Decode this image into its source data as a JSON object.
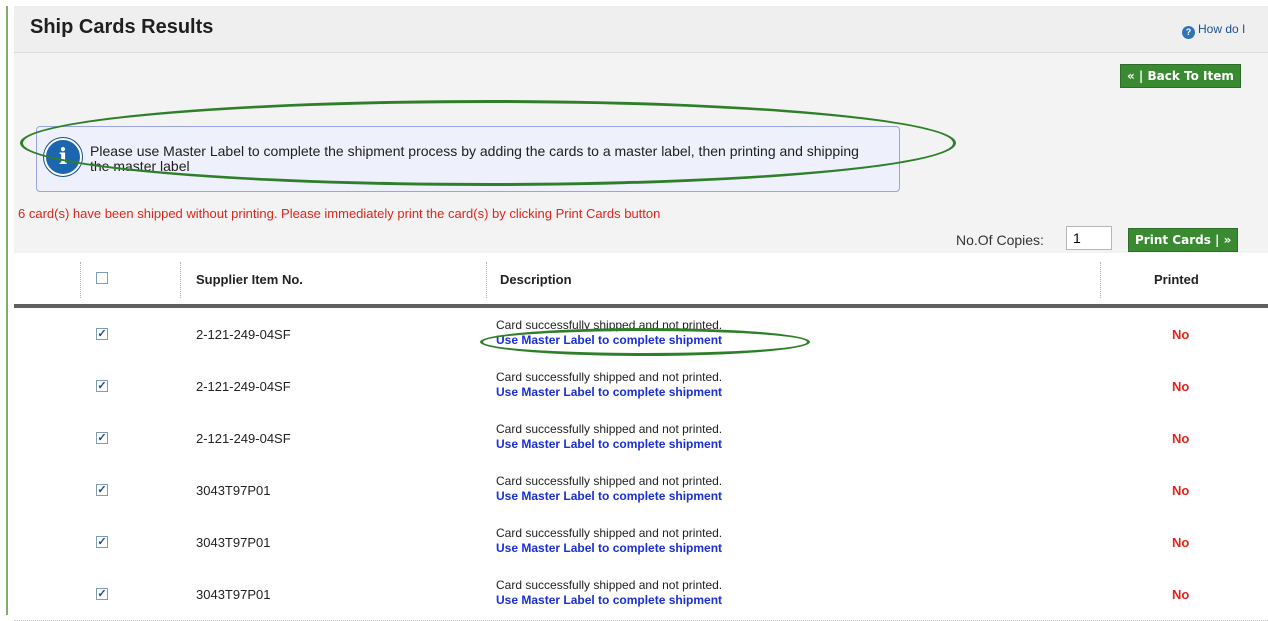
{
  "page": {
    "title": "Ship Cards Results",
    "help_link": "How do I",
    "help_icon": "question-icon"
  },
  "toolbar": {
    "back_button": "« | Back To Item",
    "print_button": "Print Cards | »",
    "copies_label": "No.Of Copies:",
    "copies_value": "1"
  },
  "info": {
    "icon": "info-icon",
    "message": "Please use Master Label to complete the shipment process by adding the cards to a master label, then printing and shipping the master label"
  },
  "warning": "6 card(s) have been shipped without printing. Please immediately print the card(s) by clicking Print Cards button",
  "table": {
    "headers": [
      "Supplier Item No.",
      "Description",
      "Printed"
    ],
    "rows": [
      {
        "checked": true,
        "item": "2-121-249-04SF",
        "desc": "Card successfully shipped and not printed.",
        "link": "Use Master Label to complete shipment",
        "printed": "No"
      },
      {
        "checked": true,
        "item": "2-121-249-04SF",
        "desc": "Card successfully shipped and not printed.",
        "link": "Use Master Label to complete shipment",
        "printed": "No"
      },
      {
        "checked": true,
        "item": "2-121-249-04SF",
        "desc": "Card successfully shipped and not printed.",
        "link": "Use Master Label to complete shipment",
        "printed": "No"
      },
      {
        "checked": true,
        "item": "3043T97P01",
        "desc": "Card successfully shipped and not printed.",
        "link": "Use Master Label to complete shipment",
        "printed": "No"
      },
      {
        "checked": true,
        "item": "3043T97P01",
        "desc": "Card successfully shipped and not printed.",
        "link": "Use Master Label to complete shipment",
        "printed": "No"
      },
      {
        "checked": true,
        "item": "3043T97P01",
        "desc": "Card successfully shipped and not printed.",
        "link": "Use Master Label to complete shipment",
        "printed": "No"
      }
    ]
  },
  "colors": {
    "button_green": "#3a8a32",
    "warning_red": "#e0251b",
    "link_blue": "#1a2fd6",
    "annotation_green": "#2f7f2a"
  }
}
